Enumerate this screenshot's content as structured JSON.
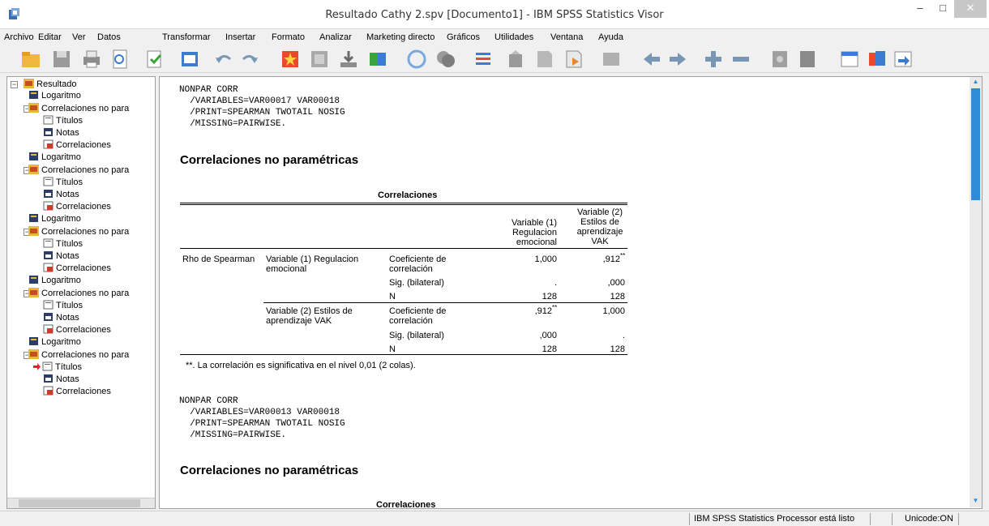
{
  "window": {
    "title": "Resultado Cathy 2.spv [Documento1] - IBM SPSS Statistics Visor",
    "min_glyph": "–",
    "max_glyph": "□",
    "close_glyph": "✕"
  },
  "menu": [
    "Archivo",
    "Editar",
    "Ver",
    "Datos",
    "Transformar",
    "Insertar",
    "Formato",
    "Analizar",
    "Marketing directo",
    "Gráficos",
    "Utilidades",
    "Ventana",
    "Ayuda"
  ],
  "toolbar_icons": [
    "open-icon",
    "save-icon",
    "print-icon",
    "print-preview-icon",
    "export-icon",
    "recall-dialog-icon",
    "undo-icon",
    "redo-icon",
    "goto-data-icon",
    "goto-case-icon",
    "goto-variable-icon",
    "variables-icon",
    "chart-icon",
    "pie-icon",
    "select-cases-icon",
    "designate-window-icon",
    "insert-output-icon",
    "insert-text-icon",
    "insert-title-icon",
    "promote-icon",
    "demote-icon",
    "expand-icon",
    "collapse-icon",
    "show-icon",
    "hide-icon",
    "insert-heading-icon",
    "insert-page-icon",
    "insert-object-icon"
  ],
  "tree": {
    "root": "Resultado",
    "items": [
      {
        "label": "Logaritmo",
        "type": "log"
      },
      {
        "label": "Correlaciones no para",
        "type": "proc"
      },
      {
        "label": "Títulos",
        "type": "title"
      },
      {
        "label": "Notas",
        "type": "notes"
      },
      {
        "label": "Correlaciones",
        "type": "table"
      },
      {
        "label": "Logaritmo",
        "type": "log"
      },
      {
        "label": "Correlaciones no para",
        "type": "proc"
      },
      {
        "label": "Títulos",
        "type": "title"
      },
      {
        "label": "Notas",
        "type": "notes"
      },
      {
        "label": "Correlaciones",
        "type": "table"
      },
      {
        "label": "Logaritmo",
        "type": "log"
      },
      {
        "label": "Correlaciones no para",
        "type": "proc"
      },
      {
        "label": "Títulos",
        "type": "title"
      },
      {
        "label": "Notas",
        "type": "notes"
      },
      {
        "label": "Correlaciones",
        "type": "table"
      },
      {
        "label": "Logaritmo",
        "type": "log"
      },
      {
        "label": "Correlaciones no para",
        "type": "proc"
      },
      {
        "label": "Títulos",
        "type": "title"
      },
      {
        "label": "Notas",
        "type": "notes"
      },
      {
        "label": "Correlaciones",
        "type": "table"
      },
      {
        "label": "Logaritmo",
        "type": "log"
      },
      {
        "label": "Correlaciones no para",
        "type": "proc"
      },
      {
        "label": "Títulos",
        "type": "title"
      },
      {
        "label": "Notas",
        "type": "notes"
      },
      {
        "label": "Correlaciones",
        "type": "table"
      }
    ]
  },
  "output": {
    "syntax1": [
      "NONPAR CORR",
      "  /VARIABLES=VAR00017 VAR00018",
      "  /PRINT=SPEARMAN TWOTAIL NOSIG",
      "  /MISSING=PAIRWISE."
    ],
    "heading1": "Correlaciones no paramétricas",
    "table_title": "Correlaciones",
    "col1_header": [
      "Variable (1)",
      "Regulacion",
      "emocional"
    ],
    "col2_header": [
      "Variable (2)",
      "Estilos de",
      "aprendizaje",
      "VAK"
    ],
    "rho": "Rho de Spearman",
    "var1_label": [
      "Variable (1) Regulacion",
      "emocional"
    ],
    "var2_label": [
      "Variable (2) Estilos de",
      "aprendizaje VAK"
    ],
    "coef_label": [
      "Coeficiente de",
      "correlación"
    ],
    "sig_label": "Sig. (bilateral)",
    "n_label": "N",
    "rows": {
      "r1": {
        "c1": "1,000",
        "c2": ",912",
        "c2sup": "**"
      },
      "r2": {
        "c1": ".",
        "c2": ",000"
      },
      "r3": {
        "c1": "128",
        "c2": "128"
      },
      "r4": {
        "c1": ",912",
        "c1sup": "**",
        "c2": "1,000"
      },
      "r5": {
        "c1": ",000",
        "c2": "."
      },
      "r6": {
        "c1": "128",
        "c2": "128"
      }
    },
    "footnote": "**. La correlación es significativa en el nivel 0,01 (2 colas).",
    "syntax2": [
      "NONPAR CORR",
      "  /VARIABLES=VAR00013 VAR00018",
      "  /PRINT=SPEARMAN TWOTAIL NOSIG",
      "  /MISSING=PAIRWISE."
    ],
    "heading2": "Correlaciones no paramétricas",
    "table_title2": "Correlaciones"
  },
  "status": {
    "processor": "IBM SPSS Statistics Processor está listo",
    "unicode": "Unicode:ON"
  }
}
